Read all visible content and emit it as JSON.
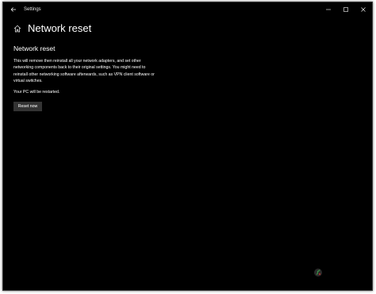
{
  "window": {
    "app_title": "Settings",
    "controls": [
      "minimize",
      "maximize",
      "close"
    ]
  },
  "header": {
    "page_title": "Network reset"
  },
  "section": {
    "title": "Network reset",
    "description": "This will remove then reinstall all your network adapters, and set other networking components back to their original settings. You might need to reinstall other networking software afterwards, such as VPN client software or virtual switches.",
    "restart_note": "Your PC will be restarted.",
    "reset_button_label": "Reset now"
  },
  "colors": {
    "background": "#000000",
    "text": "#ffffff",
    "button": "#333333"
  },
  "icons": {
    "back": "back-arrow-icon",
    "home": "home-icon",
    "minimize": "minimize-icon",
    "maximize": "maximize-icon",
    "close": "close-icon"
  }
}
